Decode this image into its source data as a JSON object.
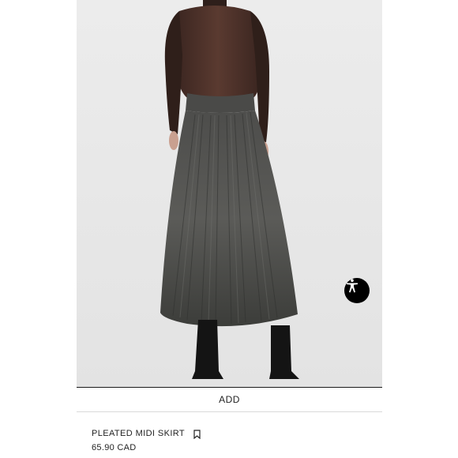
{
  "product": {
    "image_alt": "Model wearing pleated midi skirt with sheer top and black boots",
    "add_label": "ADD",
    "name": "PLEATED MIDI SKIRT",
    "price": "65.90 CAD"
  },
  "icons": {
    "accessibility": "accessibility-icon",
    "bookmark": "bookmark-icon"
  },
  "colors": {
    "accent": "#000000",
    "text": "#222222",
    "background": "#ffffff"
  }
}
